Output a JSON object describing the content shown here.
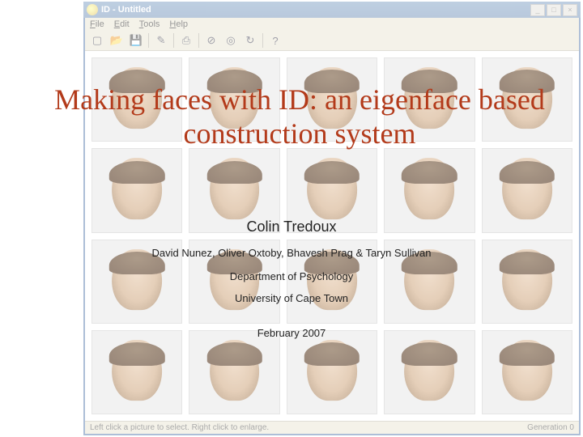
{
  "slide": {
    "title": "Making faces with ID: an eigenface based construction system",
    "lead_author": "Colin Tredoux",
    "coauthors": "David Nunez, Oliver Oxtoby, Bhavesh Prag & Taryn Sullivan",
    "department": "Department of Psychology",
    "university": "University of Cape Town",
    "date": "February  2007"
  },
  "app": {
    "title": "ID - Untitled",
    "menu": {
      "file": "File",
      "edit": "Edit",
      "tools": "Tools",
      "help": "Help"
    },
    "toolbar_icons": {
      "new": "new-icon",
      "open": "open-icon",
      "save": "save-icon",
      "wand": "wand-icon",
      "print": "print-icon",
      "no": "no-icon",
      "target": "target-icon",
      "refresh": "refresh-icon",
      "help": "help-icon"
    },
    "status_left": "Left click a picture to select.  Right click to enlarge.",
    "status_right": "Generation 0",
    "win": {
      "min": "_",
      "max": "□",
      "close": "×"
    }
  }
}
